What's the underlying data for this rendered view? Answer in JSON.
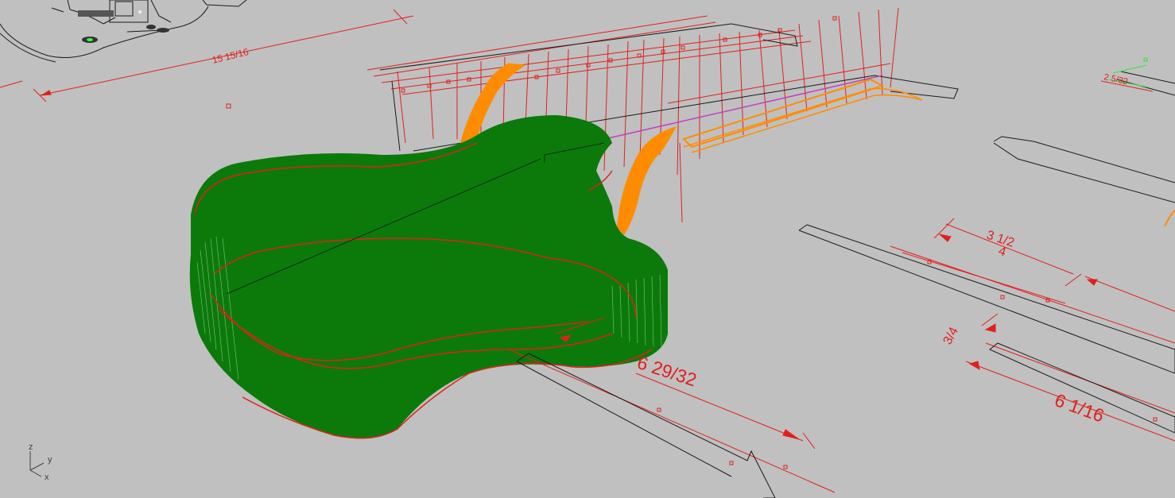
{
  "viewport": {
    "background": "#c0c0c0",
    "dimensions": {
      "overall_length": "15 15/16",
      "fretboard_small": "2 5/32",
      "neck_a": "3 1/2",
      "neck_b": "4",
      "headstock_width": "3/4",
      "headstock_length": "6 1/16",
      "body_dimension": "6 29/32"
    },
    "axis_indicator": {
      "z": "z",
      "y": "y",
      "x": "x"
    }
  },
  "colors": {
    "body_surface": "#0b7a0b",
    "curve": "#e0201c",
    "fret_line": "#e0201c",
    "neck_surface": "#ff8c00",
    "outline": "#1a1a1a",
    "highlight": "#c040c0"
  }
}
